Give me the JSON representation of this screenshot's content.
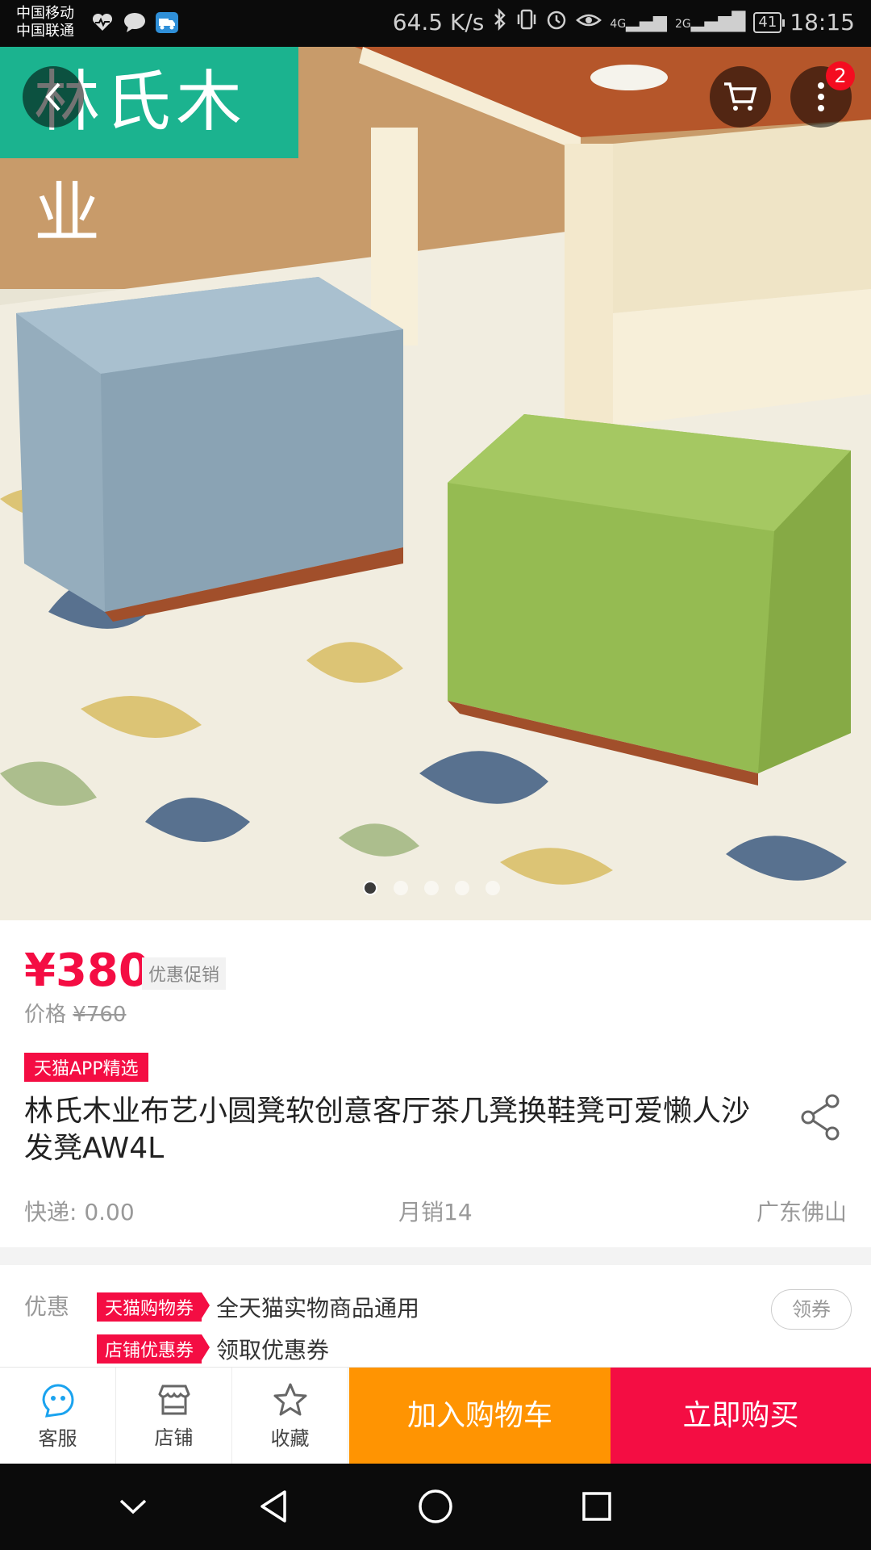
{
  "status_bar": {
    "carrier_1": "中国移动",
    "carrier_2": "中国联通",
    "net_speed": "64.5 K/s",
    "signal_4g": "4G",
    "signal_2g": "2G",
    "battery": "41",
    "time": "18:15",
    "icons": [
      "heart-pulse-icon",
      "chat-bubble-icon",
      "delivery-truck-icon",
      "bluetooth-icon",
      "vibrate-icon",
      "alarm-icon",
      "eye-icon",
      "signal-4g-icon",
      "signal-2g-icon",
      "battery-icon"
    ]
  },
  "hero": {
    "brand_text": "林氏木业",
    "cart_badge": "2",
    "image_count": 5,
    "active_image_index": 0,
    "colors": {
      "brand_green": "#1bb38f",
      "badge_red": "#f40d20"
    }
  },
  "product": {
    "price": "¥380",
    "promo_tag": "优惠促销",
    "orig_label": "价格",
    "orig_price": "¥760",
    "tmall_tag": "天猫APP精选",
    "title": "林氏木业布艺小圆凳软创意客厅茶几凳换鞋凳可爱懒人沙发凳AW4L",
    "shipping": "快递: 0.00",
    "monthly_sales": "月销14",
    "location": "广东佛山",
    "colors": {
      "price_red": "#f40d43"
    }
  },
  "coupons": {
    "label": "优惠",
    "items": [
      {
        "tag": "天猫购物券",
        "text": "全天猫实物商品通用"
      },
      {
        "tag": "店铺优惠券",
        "text": "领取优惠券"
      }
    ],
    "claim_button": "领券"
  },
  "action_bar": {
    "tools": [
      {
        "label": "客服",
        "icon": "customer-service-icon"
      },
      {
        "label": "店铺",
        "icon": "store-icon"
      },
      {
        "label": "收藏",
        "icon": "star-icon"
      }
    ],
    "add_to_cart": "加入购物车",
    "buy_now": "立即购买",
    "colors": {
      "orange": "#ff9402",
      "red": "#f40d43"
    }
  },
  "nav_bar": {
    "buttons": [
      "chevron-down-icon",
      "back-triangle-icon",
      "home-circle-icon",
      "recents-square-icon"
    ]
  }
}
